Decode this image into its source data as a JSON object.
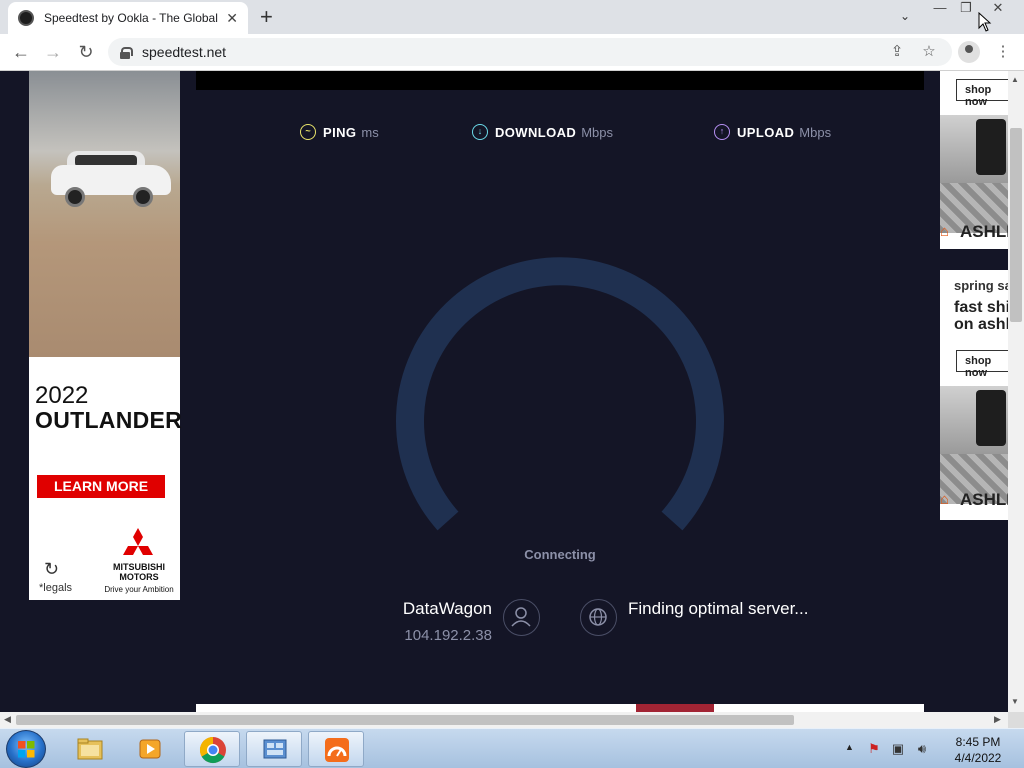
{
  "browser": {
    "tab_title": "Speedtest by Ookla - The Global",
    "tab_close": "✕",
    "new_tab": "+",
    "tab_search": "⌄",
    "url": "speedtest.net",
    "nav_back": "←",
    "nav_forward": "→",
    "nav_reload": "↻",
    "share": "⇪",
    "bookmark": "☆",
    "menu": "⋮",
    "win_minimize": "—",
    "win_restore": "❐",
    "win_close": "✕"
  },
  "speedtest": {
    "ping_label": "PING",
    "ping_unit": "ms",
    "download_label": "DOWNLOAD",
    "download_unit": "Mbps",
    "upload_label": "UPLOAD",
    "upload_unit": "Mbps",
    "status": "Connecting",
    "isp_name": "DataWagon",
    "isp_ip": "104.192.2.38",
    "server_status": "Finding optimal server...",
    "colors": {
      "ping": "#e8e36a",
      "download": "#6ad9e8",
      "upload": "#b58ff2",
      "gauge": "#1f3050"
    }
  },
  "left_ad": {
    "year": "2022",
    "model": "OUTLANDER",
    "cta": "LEARN MORE",
    "legals": "*legals",
    "brand_line1": "MITSUBISHI",
    "brand_line2": "MOTORS",
    "tagline": "Drive your Ambition",
    "cta_color": "#e00000"
  },
  "right_ad": {
    "shop_label": "shop now",
    "brand": "ASHLEY",
    "spring": "spring sale",
    "fast": "fast shipping",
    "on_ash": "on ashley"
  },
  "taskbar": {
    "time": "8:45 PM",
    "date": "4/4/2022"
  }
}
